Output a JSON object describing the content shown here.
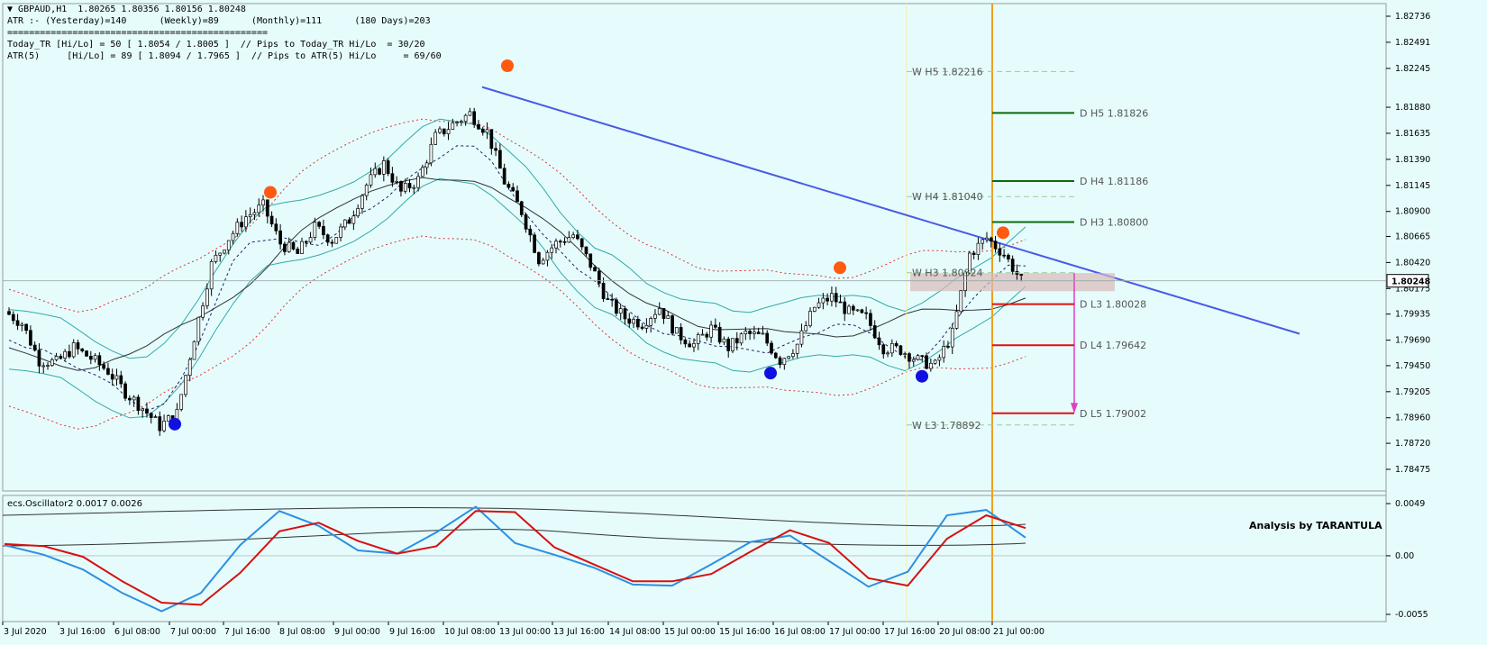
{
  "window": {
    "symbol_line": "GBPAUD,H1  1.80265 1.80356 1.80156 1.80248",
    "atr_line": "ATR :- (Yesterday)=140      (Weekly)=89      (Monthly)=111      (180 Days)=203",
    "separator": "================================================",
    "today_tr_line": "Today_TR [Hi/Lo] = 50 [ 1.8054 / 1.8005 ]  // Pips to Today_TR Hi/Lo  = 30/20",
    "atr5_line": "ATR(5)     [Hi/Lo] = 89 [ 1.8094 / 1.7965 ]  // Pips to ATR(5) Hi/Lo     = 69/60"
  },
  "levels": [
    {
      "label": "W  H5 1.82216",
      "price": 1.82216
    },
    {
      "label": "D   H5 1.81826",
      "price": 1.81826
    },
    {
      "label": "D   H4 1.81186",
      "price": 1.81186
    },
    {
      "label": "W  H4 1.81040",
      "price": 1.8104
    },
    {
      "label": "D   H3 1.80800",
      "price": 1.808
    },
    {
      "label": "W  H3 1.80324",
      "price": 1.80324
    },
    {
      "label": "D   L3 1.80028",
      "price": 1.80028
    },
    {
      "label": "D   L4 1.79642",
      "price": 1.79642
    },
    {
      "label": "D   L5 1.79002",
      "price": 1.79002
    },
    {
      "label": "W  L3 1.78892",
      "price": 1.78892
    }
  ],
  "chart_data": [
    {
      "type": "line",
      "title": "GBPAUD,H1",
      "x_ticks": [
        "3 Jul 2020",
        "3 Jul 16:00",
        "6 Jul 08:00",
        "7 Jul 00:00",
        "7 Jul 16:00",
        "8 Jul 08:00",
        "9 Jul 00:00",
        "9 Jul 16:00",
        "10 Jul 08:00",
        "13 Jul 00:00",
        "13 Jul 16:00",
        "14 Jul 08:00",
        "15 Jul 00:00",
        "15 Jul 16:00",
        "16 Jul 08:00",
        "17 Jul 00:00",
        "17 Jul 16:00",
        "20 Jul 08:00",
        "21 Jul 00:00"
      ],
      "y_ticks": [
        "1.82736",
        "1.82491",
        "1.82245",
        "1.81880",
        "1.81635",
        "1.81390",
        "1.81145",
        "1.80900",
        "1.80665",
        "1.80420",
        "1.80175",
        "1.79935",
        "1.79690",
        "1.79450",
        "1.79205",
        "1.78960",
        "1.78720",
        "1.78475"
      ],
      "ylim": [
        1.78475,
        1.82736
      ],
      "current_price": "1.80248",
      "series": [
        {
          "name": "Close",
          "values": [
            1.7996,
            1.7985,
            1.795,
            1.7948,
            1.7962,
            1.7952,
            1.794,
            1.792,
            1.7905,
            1.7888,
            1.79,
            1.7972,
            1.804,
            1.8065,
            1.8085,
            1.8095,
            1.806,
            1.805,
            1.8075,
            1.8063,
            1.8082,
            1.8115,
            1.8135,
            1.8108,
            1.812,
            1.816,
            1.8172,
            1.8182,
            1.8165,
            1.8118,
            1.809,
            1.8045,
            1.806,
            1.8068,
            1.804,
            1.8005,
            1.799,
            1.7985,
            1.8,
            1.7975,
            1.7965,
            1.798,
            1.7962,
            1.7975,
            1.7972,
            1.795,
            1.7965,
            1.8,
            1.801,
            1.7995,
            1.799,
            1.7962,
            1.796,
            1.795,
            1.7945,
            1.7975,
            1.805,
            1.8065,
            1.805,
            1.8025
          ]
        }
      ]
    },
    {
      "type": "line",
      "title": "ecs.Oscillator2 0.0017 0.0026",
      "y_ticks": [
        "0.0049",
        "0.00",
        "-0.0055"
      ],
      "ylim": [
        -0.0055,
        0.0049
      ],
      "annotation": "Analysis by TARANTULA",
      "series": [
        {
          "name": "",
          "color": "#2f8fe0",
          "values": [
            0.001,
            0.0001,
            -0.0013,
            -0.0035,
            -0.0052,
            -0.0035,
            0.001,
            0.0042,
            0.0028,
            0.0005,
            0.0002,
            0.0022,
            0.0046,
            0.0012,
            0.0001,
            -0.0011,
            -0.0027,
            -0.0028,
            -0.0008,
            0.0013,
            0.0019,
            -0.0005,
            -0.0029,
            -0.0015,
            0.0038,
            0.0043,
            0.0017
          ]
        },
        {
          "name": "",
          "color": "#d81010",
          "values": [
            0.0011,
            0.0009,
            -0.0001,
            -0.0024,
            -0.0044,
            -0.0046,
            -0.0016,
            0.0023,
            0.0031,
            0.0014,
            0.0002,
            0.0009,
            0.0042,
            0.0041,
            0.0008,
            -0.0008,
            -0.0024,
            -0.0024,
            -0.0017,
            0.0004,
            0.0024,
            0.0012,
            -0.0021,
            -0.0028,
            0.0016,
            0.0038,
            0.0026
          ]
        }
      ]
    }
  ]
}
